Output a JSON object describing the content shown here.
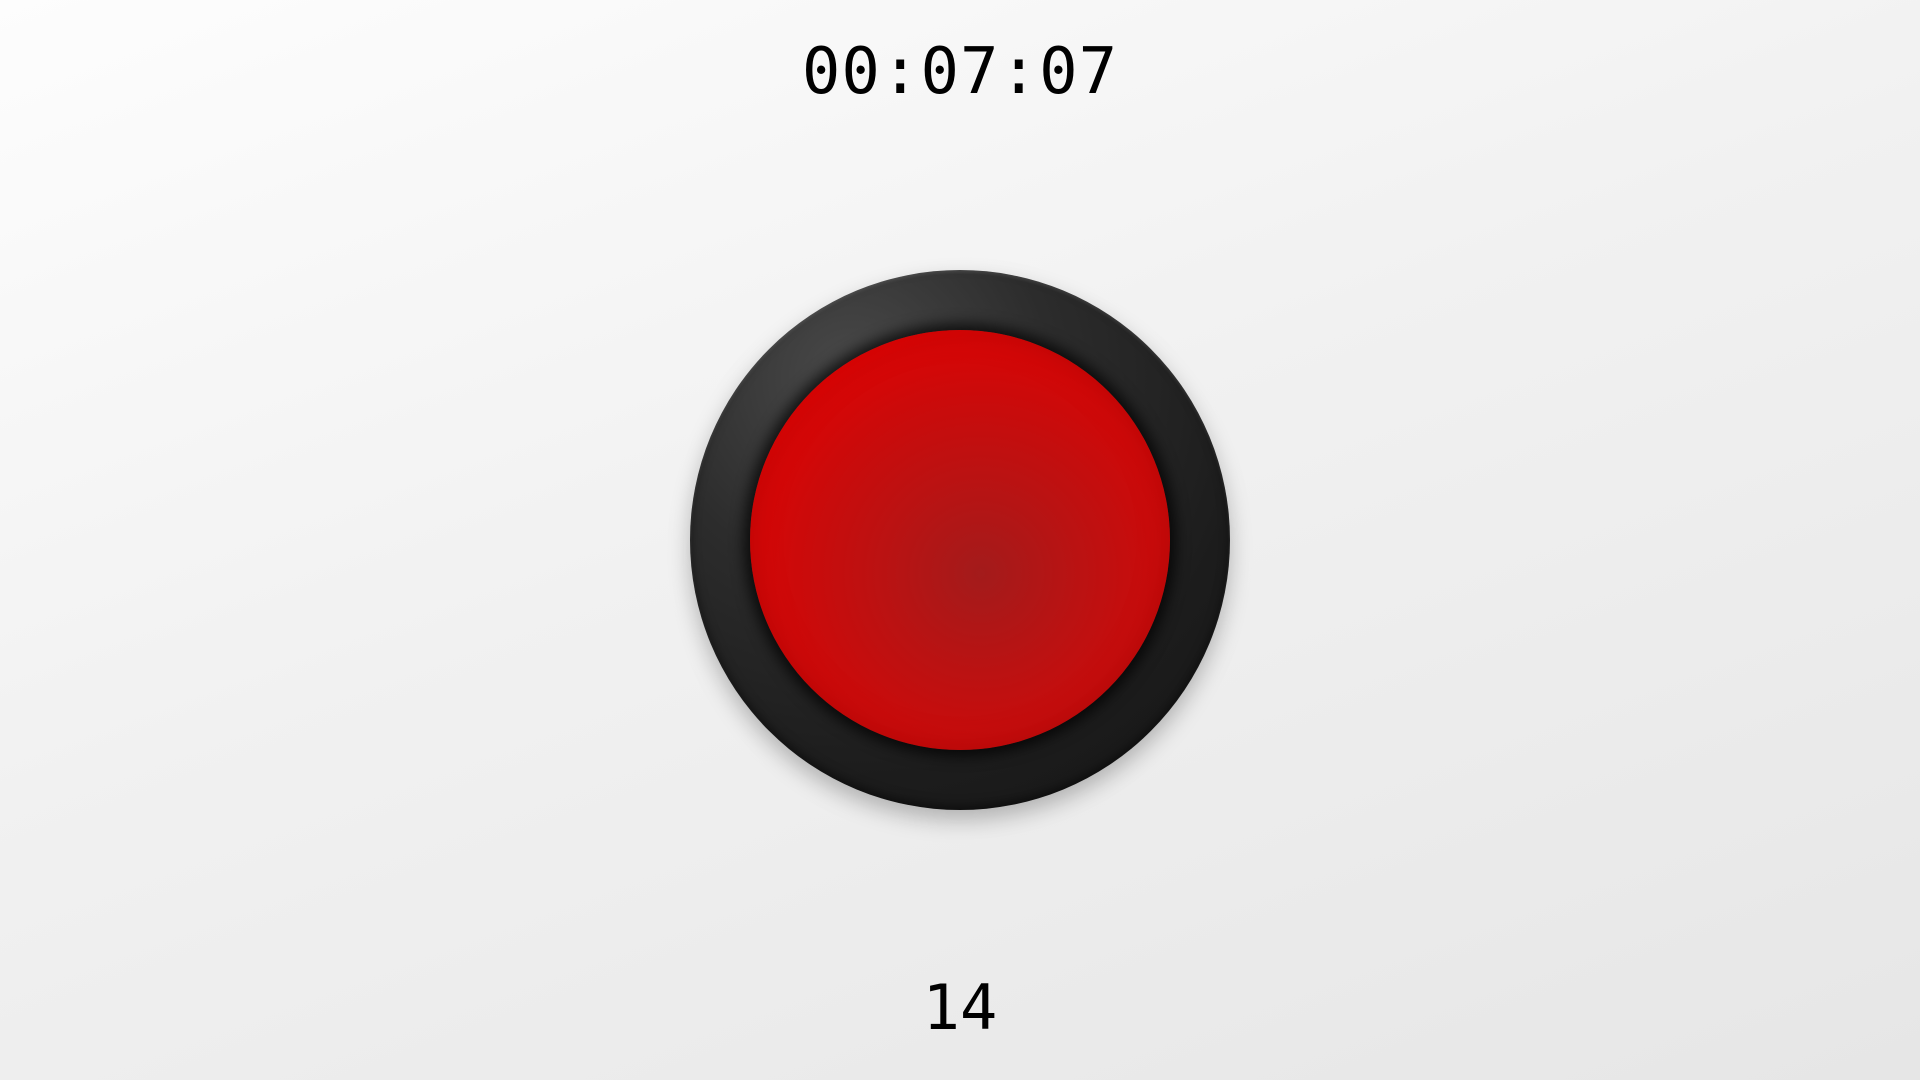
{
  "timer": {
    "value": "00:07:07"
  },
  "button": {
    "icon": "big-red-button",
    "cap_color": "#ff0000",
    "bezel_color": "#1c1c1c"
  },
  "counter": {
    "value": "14"
  },
  "colors": {
    "background": "#f0f0f0",
    "text": "#000000"
  }
}
